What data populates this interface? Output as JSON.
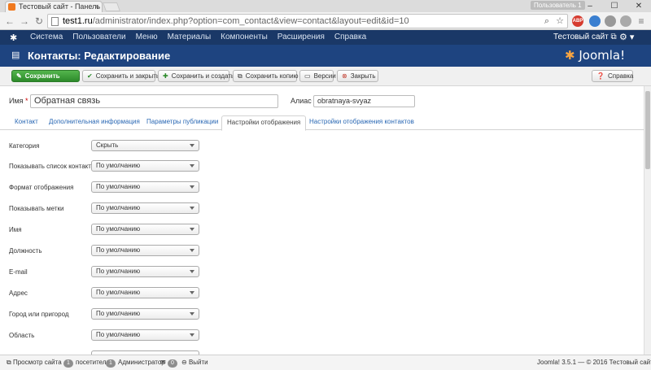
{
  "browser": {
    "tab_title": "Тестовый сайт - Панель",
    "tab_close": "×",
    "profile_label": "Пользователь 1",
    "url_host": "test1.ru",
    "url_path": "/administrator/index.php?option=com_contact&view=contact&layout=edit&id=10",
    "ext_labels": [
      "ABP"
    ],
    "win_min": "–",
    "win_max": "☐",
    "win_close": "✕",
    "nav_back": "←",
    "nav_forward": "→",
    "nav_reload": "↻",
    "menu_glyph": "≡"
  },
  "jnav": {
    "logo_glyph": "✱",
    "menu": [
      "Система",
      "Пользователи",
      "Меню",
      "Материалы",
      "Компоненты",
      "Расширения",
      "Справка"
    ],
    "site_link": "Тестовый сайт ⧉",
    "gear_glyph": "⚙ ▾"
  },
  "header": {
    "title": "Контакты: Редактирование",
    "brand": "Joomla!"
  },
  "toolbar": {
    "save": "Сохранить",
    "save_close": "Сохранить и закрыть",
    "save_new": "Сохранить и создать",
    "save_copy": "Сохранить копию",
    "versions": "Версии",
    "close": "Закрыть",
    "help": "Справка"
  },
  "form": {
    "name_label": "Имя",
    "required_mark": "*",
    "name_value": "Обратная связь",
    "alias_label": "Алиас",
    "alias_value": "obratnaya-svyaz"
  },
  "tabs": [
    "Контакт",
    "Дополнительная информация",
    "Параметры публикации",
    "Настройки отображения",
    "Настройки отображения контактов"
  ],
  "settings": [
    {
      "label": "Категория",
      "value": "Скрыть"
    },
    {
      "label": "Показывать список контактов",
      "value": "По умолчанию"
    },
    {
      "label": "Формат отображения",
      "value": "По умолчанию"
    },
    {
      "label": "Показывать метки",
      "value": "По умолчанию"
    },
    {
      "label": "Имя",
      "value": "По умолчанию"
    },
    {
      "label": "Должность",
      "value": "По умолчанию"
    },
    {
      "label": "E-mail",
      "value": "По умолчанию"
    },
    {
      "label": "Адрес",
      "value": "По умолчанию"
    },
    {
      "label": "Город или пригород",
      "value": "По умолчанию"
    },
    {
      "label": "Область",
      "value": "По умолчанию"
    }
  ],
  "status": {
    "view_site": "Просмотр сайта",
    "visitors_count": "1",
    "visitors_label": "посетитель",
    "admins_count": "1",
    "admins_label": "Администратор",
    "messages_count": "0",
    "logout": "Выйти",
    "version": "Joomla! 3.5.1 — © 2016 Тестовый сайт"
  },
  "colors": {
    "nav_bg": "#1a3867",
    "header_bg": "#1e4480",
    "save_green": "#2c8a2a",
    "link_blue": "#2a68b4"
  }
}
